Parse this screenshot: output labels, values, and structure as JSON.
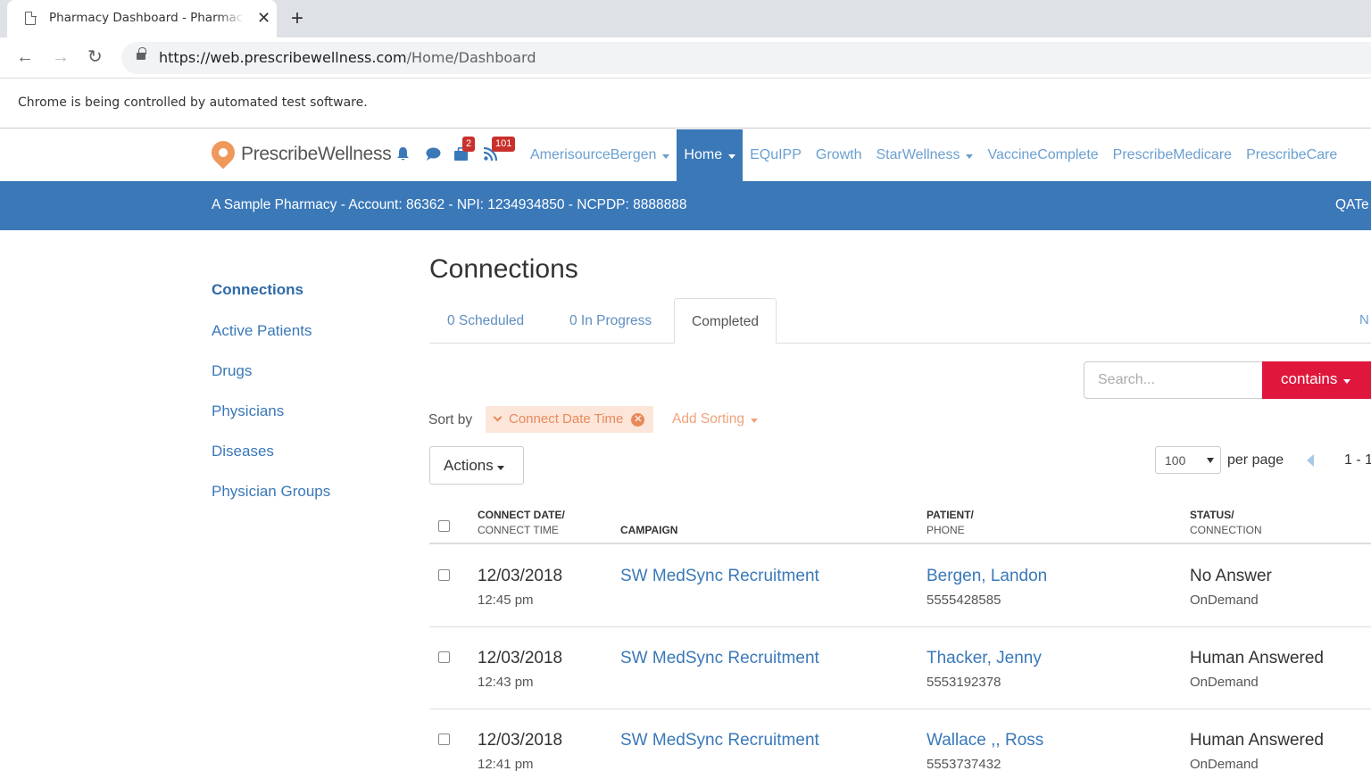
{
  "browser": {
    "tab_title": "Pharmacy Dashboard - Pharmacy",
    "url_host": "https://web.prescribewellness.com",
    "url_path": "/Home/Dashboard",
    "infobar": "Chrome is being controlled by automated test software."
  },
  "header": {
    "logo": "PrescribeWellness",
    "badges": {
      "bag": "2",
      "feed": "101"
    },
    "nav": [
      {
        "label": "AmerisourceBergen",
        "dropdown": true
      },
      {
        "label": "Home",
        "dropdown": true,
        "active": true
      },
      {
        "label": "EQuIPP"
      },
      {
        "label": "Growth"
      },
      {
        "label": "StarWellness",
        "dropdown": true
      },
      {
        "label": "VaccineComplete"
      },
      {
        "label": "PrescribeMedicare"
      },
      {
        "label": "PrescribeCare"
      }
    ]
  },
  "account": {
    "info": "A Sample Pharmacy - Account: 86362 - NPI: 1234934850 - NCPDP: 8888888",
    "user": "QATe"
  },
  "sidebar": {
    "items": [
      {
        "label": "Connections",
        "active": true
      },
      {
        "label": "Active Patients"
      },
      {
        "label": "Drugs"
      },
      {
        "label": "Physicians"
      },
      {
        "label": "Diseases"
      },
      {
        "label": "Physician Groups"
      }
    ]
  },
  "main": {
    "title": "Connections",
    "tabs": [
      {
        "label": "0 Scheduled"
      },
      {
        "label": "0 In Progress"
      },
      {
        "label": "Completed",
        "active": true
      }
    ],
    "tab_overflow": "N",
    "search": {
      "placeholder": "Search...",
      "mode": "contains"
    },
    "sort": {
      "label": "Sort by",
      "active_sort": "Connect Date Time",
      "add_label": "Add Sorting"
    },
    "actions_label": "Actions",
    "paging": {
      "per_page_value": "100",
      "per_page_label": "per page",
      "range": "1 - 1"
    },
    "table": {
      "headers": {
        "date_main": "CONNECT DATE/",
        "date_sub": "CONNECT TIME",
        "campaign": "CAMPAIGN",
        "patient_main": "PATIENT/",
        "patient_sub": "PHONE",
        "status_main": "STATUS/",
        "status_sub": "CONNECTION"
      },
      "rows": [
        {
          "date": "12/03/2018",
          "time": "12:45 pm",
          "campaign": "SW MedSync Recruitment",
          "patient": "Bergen, Landon",
          "phone": "5555428585",
          "status": "No Answer",
          "connection": "OnDemand"
        },
        {
          "date": "12/03/2018",
          "time": "12:43 pm",
          "campaign": "SW MedSync Recruitment",
          "patient": "Thacker, Jenny",
          "phone": "5553192378",
          "status": "Human Answered",
          "connection": "OnDemand"
        },
        {
          "date": "12/03/2018",
          "time": "12:41 pm",
          "campaign": "SW MedSync Recruitment",
          "patient": "Wallace ,, Ross",
          "phone": "5553737432",
          "status": "Human Answered",
          "connection": "OnDemand"
        }
      ]
    }
  },
  "colors": {
    "brand_blue": "#3a78b8",
    "accent_red": "#e0173d",
    "sort_orange": "#e8895a"
  }
}
